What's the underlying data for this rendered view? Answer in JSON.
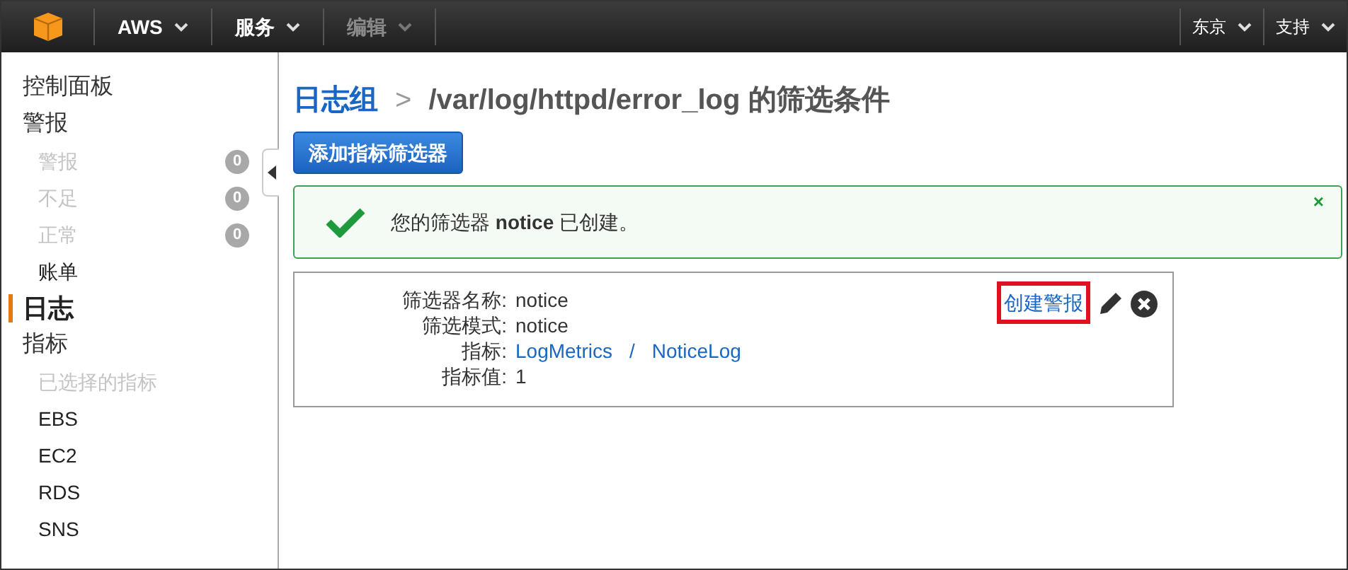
{
  "top_bar": {
    "menus": [
      {
        "label": "AWS",
        "disabled": false
      },
      {
        "label": "服务",
        "disabled": false
      },
      {
        "label": "编辑",
        "disabled": true
      }
    ],
    "right_menus": [
      {
        "label": "东京"
      },
      {
        "label": "支持"
      }
    ]
  },
  "sidebar": {
    "items": [
      {
        "label": "控制面板",
        "selected": false
      },
      {
        "label": "警报",
        "selected": false,
        "children": [
          {
            "label": "警报",
            "disabled": true,
            "count": "0"
          },
          {
            "label": "不足",
            "disabled": true,
            "count": "0"
          },
          {
            "label": "正常",
            "disabled": true,
            "count": "0"
          },
          {
            "label": "账单",
            "disabled": false
          }
        ]
      },
      {
        "label": "日志",
        "selected": true
      },
      {
        "label": "指标",
        "selected": false,
        "children": [
          {
            "label": "已选择的指标",
            "disabled": true
          },
          {
            "label": "EBS",
            "disabled": false
          },
          {
            "label": "EC2",
            "disabled": false
          },
          {
            "label": "RDS",
            "disabled": false
          },
          {
            "label": "SNS",
            "disabled": false
          }
        ]
      }
    ]
  },
  "breadcrumb": {
    "parent": "日志组",
    "separator": ">",
    "current": "/var/log/httpd/error_log 的筛选条件"
  },
  "add_button": "添加指标筛选器",
  "alert": {
    "message": "您的筛选器 **notice** 已创建。",
    "close": "×"
  },
  "filter": {
    "create_alarm": {
      "label": "创建警报",
      "highlighted": true
    },
    "rows": [
      {
        "kind": "text",
        "label": "筛选器名称:",
        "value": "notice"
      },
      {
        "kind": "text",
        "label": "筛选模式:",
        "value": "notice"
      },
      {
        "kind": "metric",
        "label": "指标:",
        "namespace": "LogMetrics",
        "separator": "/",
        "metric": "NoticeLog"
      },
      {
        "kind": "text",
        "label": "指标值:",
        "value": "1"
      }
    ]
  }
}
